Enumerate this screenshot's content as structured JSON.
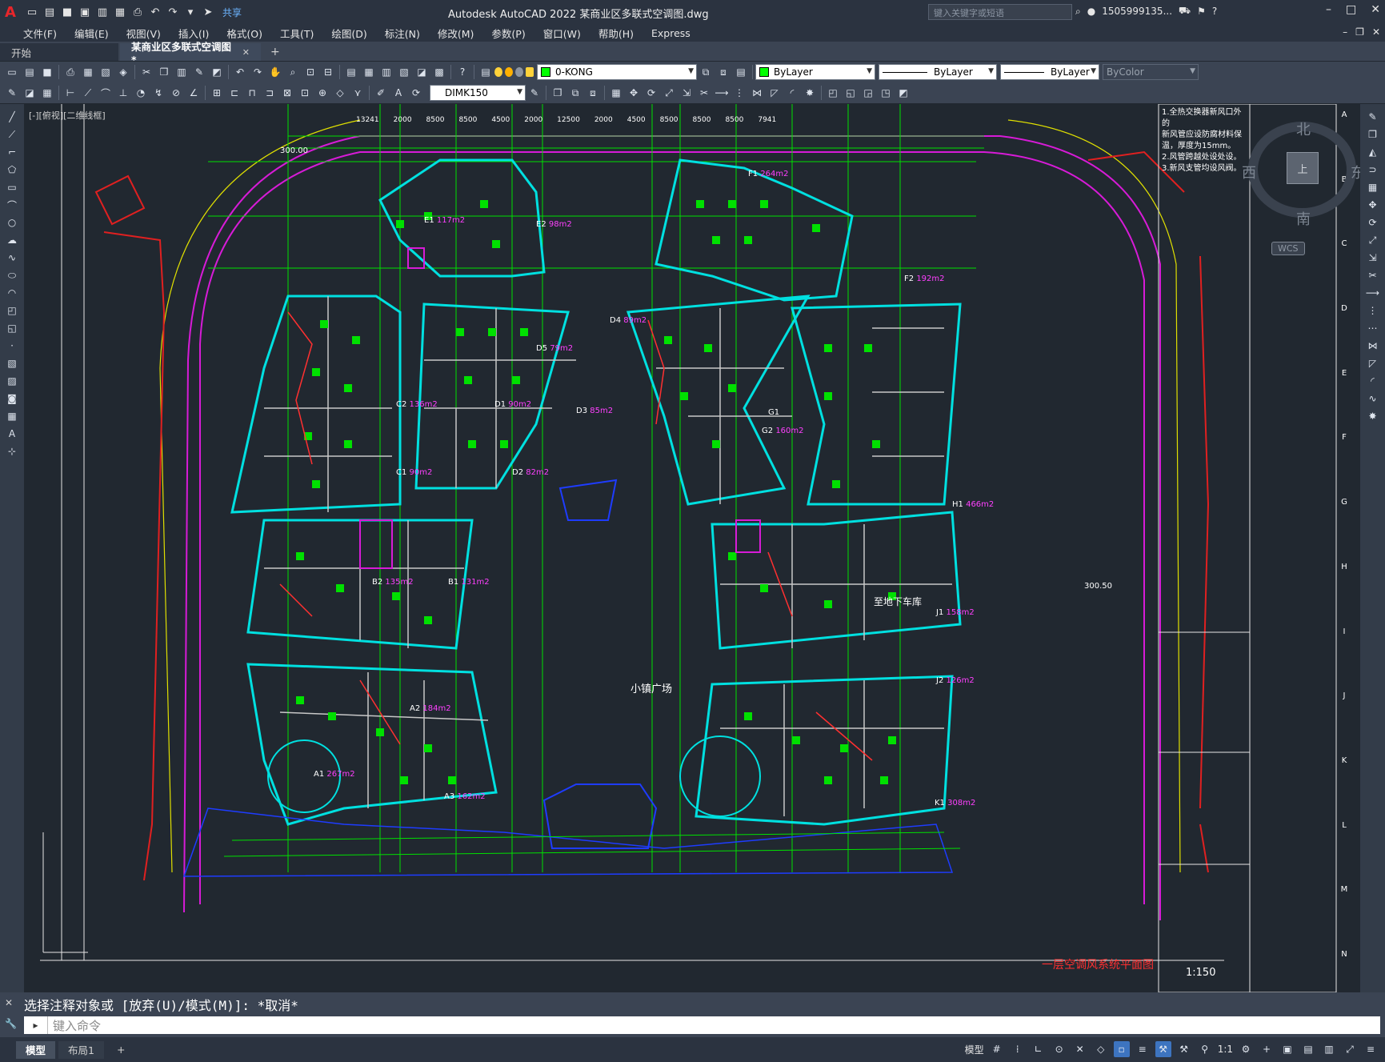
{
  "app": {
    "title": "Autodesk AutoCAD 2022    某商业区多联式空调图.dwg",
    "search_placeholder": "键入关键字或短语",
    "user": "1505999135...",
    "share": "共享"
  },
  "menus": [
    "文件(F)",
    "编辑(E)",
    "视图(V)",
    "插入(I)",
    "格式(O)",
    "工具(T)",
    "绘图(D)",
    "标注(N)",
    "修改(M)",
    "参数(P)",
    "窗口(W)",
    "帮助(H)",
    "Express"
  ],
  "tabs": {
    "start": "开始",
    "drawing": "某商业区多联式空调图*"
  },
  "layer_combo": {
    "value": "0-KONG",
    "color": "#00ff00"
  },
  "props": {
    "color": "ByLayer",
    "linetype": "ByLayer",
    "lineweight": "ByLayer",
    "plotstyle": "ByColor"
  },
  "dimstyle": "DIMK150",
  "view": {
    "control": "[-][俯视][二维线框]"
  },
  "compass": {
    "north": "北",
    "south": "南",
    "east": "东",
    "west": "西",
    "top": "上",
    "wcs": "WCS"
  },
  "drawing": {
    "title": "一层空调风系统平面图",
    "scale": "1:150",
    "center_plaza": "小镇广场",
    "underground_label": "至地下车库",
    "notes": [
      "1.全热交换器新风口外的",
      "新风管应设防腐材料保",
      "温，厚度为15mm。",
      "2.风管跨越处设处设。",
      "3.新风支管均设风阀。"
    ],
    "top_dims": [
      "13241",
      "2000",
      "8500",
      "8500",
      "4500",
      "2000",
      "12500",
      "2000",
      "4500",
      "8500",
      "8500",
      "8500",
      "7941"
    ],
    "grid_right": [
      "A",
      "B",
      "C",
      "D",
      "E",
      "F",
      "G",
      "H",
      "I",
      "J",
      "K",
      "L",
      "M",
      "N"
    ],
    "rooms": [
      {
        "label": "E1",
        "area": "117m2"
      },
      {
        "label": "E2",
        "area": "98m2"
      },
      {
        "label": "F1",
        "area": "264m2"
      },
      {
        "label": "F2",
        "area": "192m2"
      },
      {
        "label": "D4",
        "area": "89m2"
      },
      {
        "label": "D5",
        "area": "79m2"
      },
      {
        "label": "D3",
        "area": "85m2"
      },
      {
        "label": "D2",
        "area": "82m2"
      },
      {
        "label": "D1",
        "area": "90m2"
      },
      {
        "label": "G1",
        "area": ""
      },
      {
        "label": "G2",
        "area": "160m2"
      },
      {
        "label": "H1",
        "area": "466m2"
      },
      {
        "label": "C2",
        "area": "136m2"
      },
      {
        "label": "C1",
        "area": "90m2"
      },
      {
        "label": "B2",
        "area": "135m2"
      },
      {
        "label": "B1",
        "area": "131m2"
      },
      {
        "label": "J1",
        "area": "158m2"
      },
      {
        "label": "J2",
        "area": "126m2"
      },
      {
        "label": "A2",
        "area": "184m2"
      },
      {
        "label": "A1",
        "area": "267m2"
      },
      {
        "label": "A3",
        "area": "162m2"
      },
      {
        "label": "K1",
        "area": "308m2"
      }
    ],
    "elev_left": "300.00",
    "elev_right": "300.50"
  },
  "command": {
    "history": "选择注释对象或 [放弃(U)/模式(M)]: *取消*",
    "placeholder": "键入命令"
  },
  "layouts": [
    "模型",
    "布局1"
  ],
  "status": {
    "model": "模型",
    "annoscale": "1:1"
  }
}
